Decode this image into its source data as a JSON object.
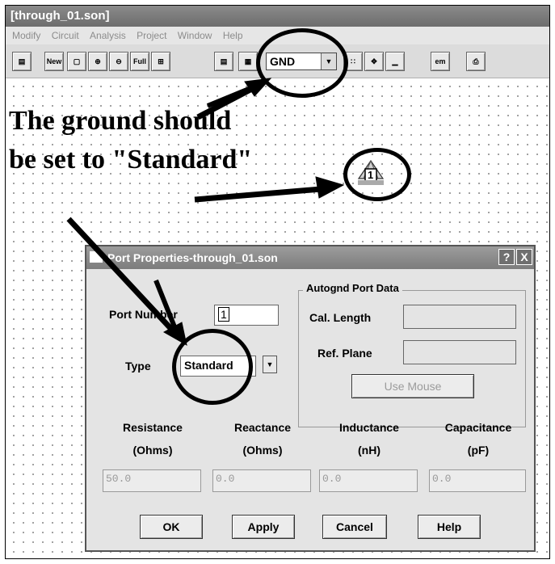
{
  "window": {
    "title": "[through_01.son]",
    "menu": [
      "Modify",
      "Circuit",
      "Analysis",
      "Project",
      "Window",
      "Help"
    ]
  },
  "toolbar": {
    "new_label": "New",
    "full_label": "Full",
    "ground_value": "GND",
    "em_label": "em"
  },
  "annotation": {
    "line1": "The ground should",
    "line2": "be set to \"Standard\""
  },
  "port_icon": {
    "number": "1"
  },
  "dialog": {
    "title": "Port Properties-through_01.son",
    "help_symbol": "?",
    "close_symbol": "X",
    "port_number_label": "Port Number",
    "port_number_value": "1",
    "type_label": "Type",
    "type_value": "Standard",
    "autognd": {
      "title": "Autognd Port Data",
      "cal_length_label": "Cal. Length",
      "cal_length_value": "",
      "ref_plane_label": "Ref. Plane",
      "ref_plane_value": "",
      "use_mouse_label": "Use Mouse"
    },
    "params": [
      {
        "label": "Resistance",
        "unit": "(Ohms)",
        "value": "50.0"
      },
      {
        "label": "Reactance",
        "unit": "(Ohms)",
        "value": "0.0"
      },
      {
        "label": "Inductance",
        "unit": "(nH)",
        "value": "0.0"
      },
      {
        "label": "Capacitance",
        "unit": "(pF)",
        "value": "0.0"
      }
    ],
    "buttons": {
      "ok": "OK",
      "apply": "Apply",
      "cancel": "Cancel",
      "help": "Help"
    }
  }
}
